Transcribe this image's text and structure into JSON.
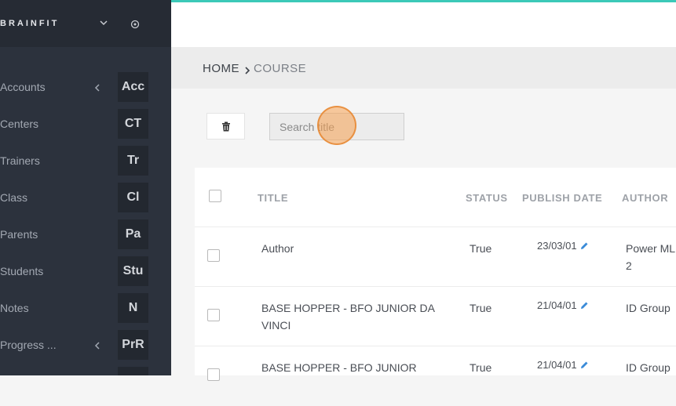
{
  "brand": {
    "name": "BRAINFIT",
    "chevron_icon": "chevron-down-icon",
    "settings_icon": "gear-icon"
  },
  "colors": {
    "accent": "#3cc9b8",
    "sidebar_bg": "#2c323d",
    "pencil": "#3b8bd8",
    "cursor": "#f5a050"
  },
  "sidebar": {
    "items": [
      {
        "label": "Accounts",
        "abbr": "Acc",
        "has_caret": true
      },
      {
        "label": "Centers",
        "abbr": "CT",
        "has_caret": false
      },
      {
        "label": "Trainers",
        "abbr": "Tr",
        "has_caret": false
      },
      {
        "label": "Class",
        "abbr": "Cl",
        "has_caret": false
      },
      {
        "label": "Parents",
        "abbr": "Pa",
        "has_caret": false
      },
      {
        "label": "Students",
        "abbr": "Stu",
        "has_caret": false
      },
      {
        "label": "Notes",
        "abbr": "N",
        "has_caret": false
      },
      {
        "label": "Progress ...",
        "abbr": "PrR",
        "has_caret": true
      }
    ]
  },
  "breadcrumb": {
    "home": "HOME",
    "current": "COURSE"
  },
  "toolbar": {
    "delete_icon": "trash-icon",
    "search_placeholder": "Search title",
    "search_value": ""
  },
  "table": {
    "headers": {
      "title": "TITLE",
      "status": "STATUS",
      "publish_date": "PUBLISH DATE",
      "author": "AUTHOR"
    },
    "rows": [
      {
        "title": "Author",
        "status": "True",
        "publish_date": "23/03/01",
        "author": "Power ML 2"
      },
      {
        "title": "BASE HOPPER - BFO JUNIOR DA VINCI",
        "status": "True",
        "publish_date": "21/04/01",
        "author": "ID Group"
      },
      {
        "title": "BASE HOPPER - BFO JUNIOR",
        "status": "True",
        "publish_date": "21/04/01",
        "author": "ID Group"
      }
    ]
  }
}
